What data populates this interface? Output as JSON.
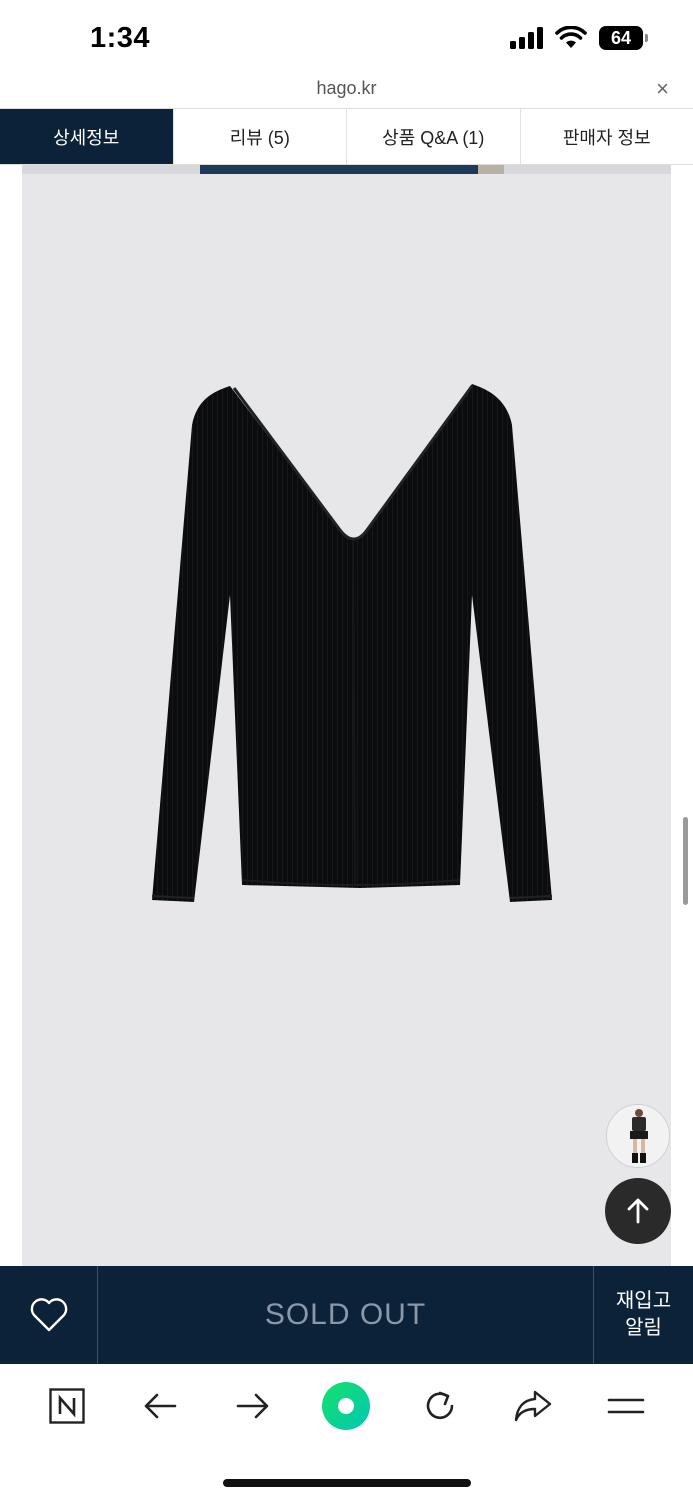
{
  "status_bar": {
    "time": "1:34",
    "battery": "64"
  },
  "url_bar": {
    "domain": "hago.kr",
    "close_glyph": "×"
  },
  "tabs": [
    {
      "label": "상세정보",
      "active": true
    },
    {
      "label": "리뷰 (5)",
      "active": false
    },
    {
      "label": "상품 Q&A (1)",
      "active": false
    },
    {
      "label": "판매자 정보",
      "active": false
    }
  ],
  "product_image": {
    "subject": "black v-neck ribbed knit top"
  },
  "floating": {
    "thumbnail_icon": "recent-item-thumbnail",
    "top_icon": "arrow-up-icon"
  },
  "buy_bar": {
    "wish_icon": "heart-icon",
    "sold_out_label": "SOLD OUT",
    "restock_label_line1": "재입고",
    "restock_label_line2": "알림"
  },
  "browser_toolbar": {
    "items": [
      "naver-home-icon",
      "back-arrow-icon",
      "forward-arrow-icon",
      "green-dot-icon",
      "reload-icon",
      "share-icon",
      "menu-icon"
    ]
  },
  "colors": {
    "navy": "#0c2238",
    "green": "#03c75a",
    "image_bg": "#e7e7e9"
  }
}
